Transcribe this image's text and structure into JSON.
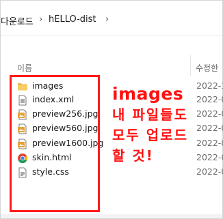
{
  "breadcrumb": {
    "parent": "다운로드",
    "separator_1": "›",
    "current": "hELLO-dist",
    "separator_2": "›"
  },
  "columns": {
    "name": "이름",
    "date": "수정한"
  },
  "files": [
    {
      "name": "images",
      "type": "folder",
      "date": "2022-1"
    },
    {
      "name": "index.xml",
      "type": "xml",
      "date": "2022-0"
    },
    {
      "name": "preview256.jpg",
      "type": "jpg",
      "date": "2022-0"
    },
    {
      "name": "preview560.jpg",
      "type": "jpg",
      "date": "2022-0"
    },
    {
      "name": "preview1600.jpg",
      "type": "jpg",
      "date": "2022-0"
    },
    {
      "name": "skin.html",
      "type": "html",
      "date": "2022-0"
    },
    {
      "name": "style.css",
      "type": "css",
      "date": "2022-0"
    }
  ],
  "annotation": {
    "title": "images",
    "line1": "내 파일들도",
    "line2": "모두 업로드",
    "line3": "할 것!"
  },
  "colors": {
    "annotation": "#ff1010",
    "highlight_border": "#ff1a1a",
    "folder": "#e8b84a",
    "jpg": "#e6a23a"
  }
}
